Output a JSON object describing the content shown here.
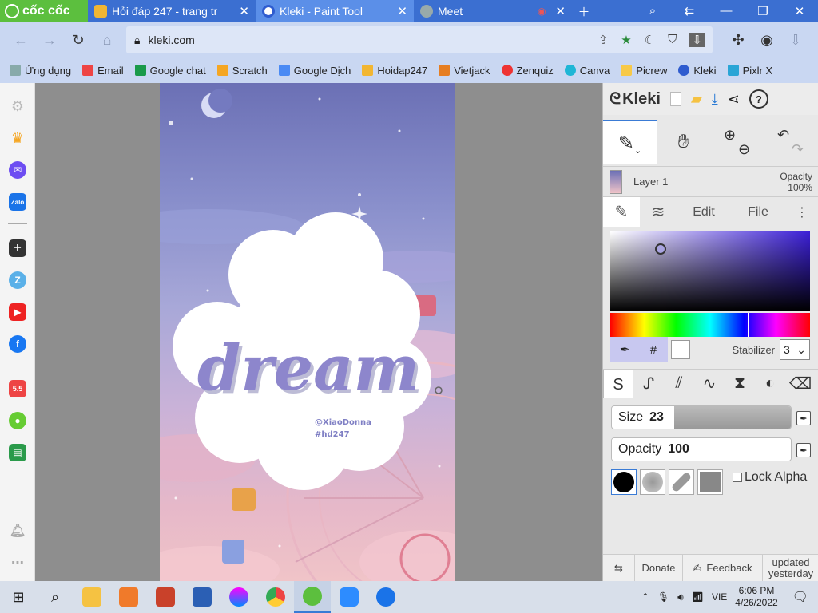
{
  "browser": {
    "brand": "cốc cốc",
    "tabs": [
      {
        "title": "Hỏi đáp 247 - trang tr",
        "color": "#f2b632"
      },
      {
        "title": "Kleki - Paint Tool",
        "color": "#2f5ccf"
      },
      {
        "title": "Meet",
        "color": "#9aa"
      }
    ],
    "url": "kleki.com",
    "bookmarks": [
      "Ứng dụng",
      "Email",
      "Google chat",
      "Scratch",
      "Google Dịch",
      "Hoidap247",
      "Vietjack",
      "Zenquiz",
      "Canva",
      "Picrew",
      "Kleki",
      "Pixlr X"
    ]
  },
  "artwork": {
    "title": "dream",
    "credit1": "@XiaoDonna",
    "credit2": "#hd247"
  },
  "kleki": {
    "logo": "Kleki",
    "layer_name": "Layer 1",
    "opacity_label": "Opacity",
    "opacity_value": "100%",
    "tab_edit": "Edit",
    "tab_file": "File",
    "hash": "#",
    "stabilizer_label": "Stabilizer",
    "stabilizer_value": "3",
    "size_label": "Size",
    "size_value": "23",
    "size_fraction": 0.35,
    "opacity2_label": "Opacity",
    "opacity2_value": "100",
    "opacity2_fraction": 1.0,
    "lock_alpha": "Lock Alpha",
    "donate": "Donate",
    "feedback": "Feedback",
    "updated1": "updated",
    "updated2": "yesterday"
  },
  "taskbar": {
    "lang": "VIE",
    "time": "6:06 PM",
    "date": "4/26/2022"
  }
}
